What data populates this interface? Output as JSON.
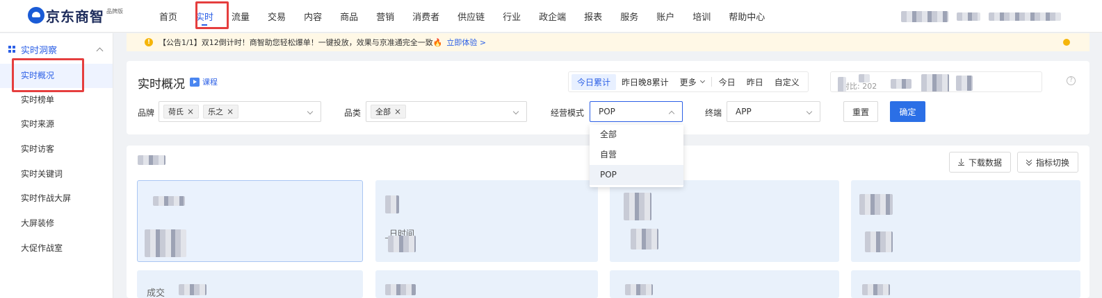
{
  "brand": {
    "name": "京东商智",
    "edition": "品牌版"
  },
  "nav": [
    "首页",
    "实时",
    "流量",
    "交易",
    "内容",
    "商品",
    "营销",
    "消费者",
    "供应链",
    "行业",
    "政企端",
    "报表",
    "服务",
    "账户",
    "培训",
    "帮助中心"
  ],
  "nav_active": "实时",
  "sidebar": {
    "group": "实时洞察",
    "items": [
      "实时概况",
      "实时榜单",
      "实时来源",
      "实时访客",
      "实时关键词",
      "实时作战大屏",
      "大屏装修",
      "大促作战室"
    ],
    "active": "实时概况"
  },
  "notice": {
    "text": "【公告1/1】双12倒计时！商智助您轻松爆单！一键投放，效果与京准通完全一致🔥",
    "link": "立即体验 >"
  },
  "page": {
    "title": "实时概况",
    "course": "课程"
  },
  "range_tabs": [
    "今日累计",
    "昨日晚8累计",
    "更多",
    "今日",
    "昨日",
    "自定义"
  ],
  "range_active": "今日累计",
  "date_partial": "对比: 202",
  "filters": {
    "brand_label": "品牌",
    "brand_tags": [
      "荷氏",
      "乐之"
    ],
    "category_label": "品类",
    "category_tags": [
      "全部"
    ],
    "mode_label": "经营模式",
    "mode_value": "POP",
    "terminal_label": "终端",
    "terminal_value": "APP",
    "reset": "重置",
    "confirm": "确定"
  },
  "mode_options": [
    "全部",
    "自营",
    "POP"
  ],
  "mode_selected": "POP",
  "content": {
    "download": "下载数据",
    "switch": "指标切换",
    "card_partial_1": "_日时间",
    "card_partial_2": "成交"
  },
  "colors": {
    "accent": "#2b5fe6",
    "highlight_box": "#e53e3e",
    "confirm_button": "#2b6fe6",
    "notice_bg": "#fff8e6"
  }
}
